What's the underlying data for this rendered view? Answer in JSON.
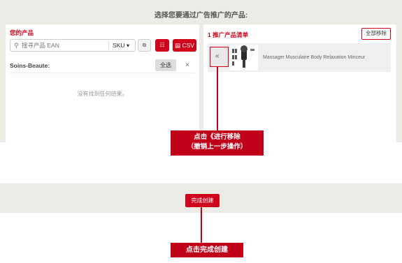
{
  "page": {
    "heading": "选择您要通过广告推广的产品:"
  },
  "left_panel": {
    "title": "您的产品",
    "search": {
      "placeholder": "搜寻产品 EAN",
      "type_select": "SKU ▾"
    },
    "toolbar": {
      "copy_icon": "⧉",
      "list_icon": "☷",
      "csv_label": "CSV"
    },
    "category_label": "Soins-Beaute:",
    "select_all_label": "全选",
    "close_label": "×",
    "empty_message": "没有找到任何结果。"
  },
  "right_panel": {
    "title": "1 推广产品清单",
    "remove_all_label": "全部移除",
    "products": [
      {
        "move_back_glyph": "«",
        "name": "Massager Musculaire Body Relaxation Minceur"
      }
    ]
  },
  "finish_button_label": "完成创建",
  "annotations": {
    "callout_remove_line1": "点击《进行移除",
    "callout_remove_line2": "（撤销上一步操作）",
    "callout_finish": "点击完成创建"
  },
  "colors": {
    "accent_red": "#d0021b",
    "background_band": "#ecebe6"
  }
}
